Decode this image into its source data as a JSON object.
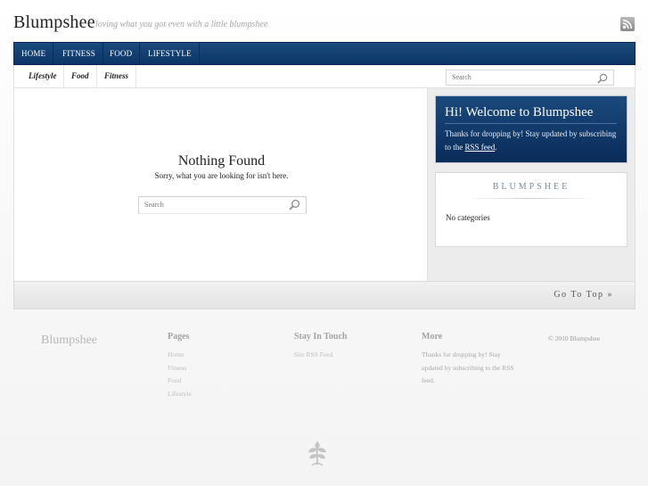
{
  "header": {
    "site_title": "Blumpshee",
    "tagline": "loving what you got even with a little blumpshee",
    "rss_icon": "rss-icon"
  },
  "nav": {
    "items": [
      "Home",
      "Fitness",
      "Food",
      "Lifestyle"
    ]
  },
  "subnav": {
    "items": [
      "Lifestyle",
      "Food",
      "Fitness"
    ],
    "search_placeholder": "Search",
    "search_icon": "magnifier-icon"
  },
  "content": {
    "title": "Nothing Found",
    "message": "Sorry, what you are looking for isn't here.",
    "search_placeholder": "Search"
  },
  "sidebar": {
    "welcome_title": "Hi! Welcome to Blumpshee",
    "welcome_text_before": "Thanks for dropping by! Stay updated by subscribing to the ",
    "welcome_link": "RSS feed",
    "welcome_text_after": ".",
    "categories_title": "BLUMPSHEE",
    "categories_empty": "No categories"
  },
  "goto_top": "Go To Top »",
  "footer": {
    "logo": "Blumpshee",
    "pages_heading": "Pages",
    "pages": [
      "Home",
      "Fitness",
      "Food",
      "Lifestyle"
    ],
    "touch_heading": "Stay In Touch",
    "touch_link": "Site RSS Feed",
    "more_heading": "More",
    "more_text": "Thanks for dropping by! Stay updated by subscribing to the RSS feed.",
    "copyright": "© 2010 Blumpshee",
    "leaf_icon": "leaf-icon"
  },
  "colors": {
    "nav_blue": "#0d3466",
    "welcome_blue": "#0a2b58"
  }
}
